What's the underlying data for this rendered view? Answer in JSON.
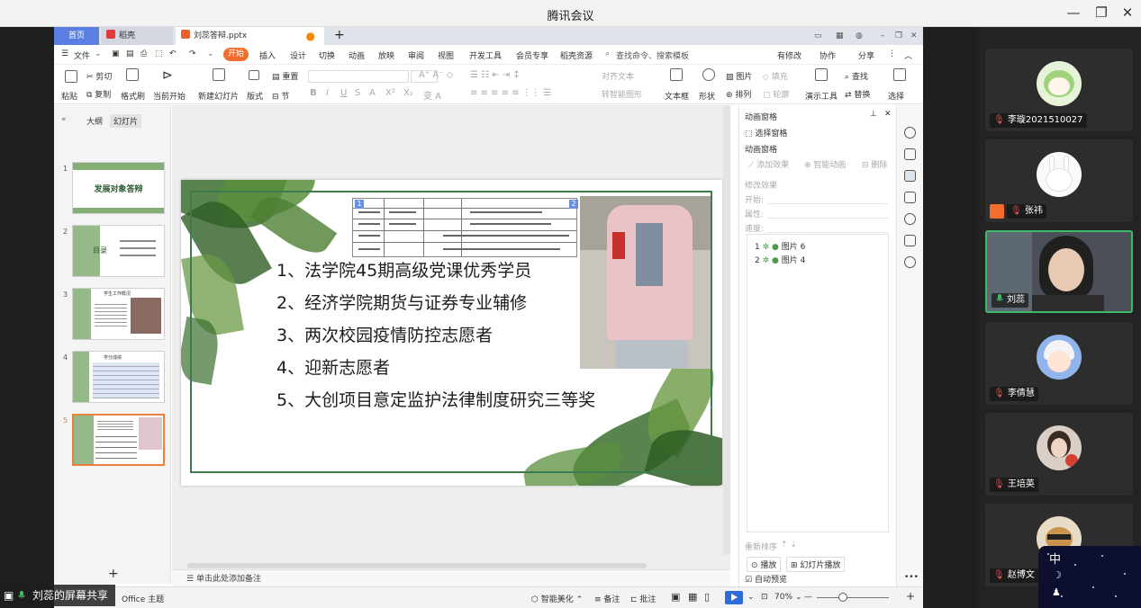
{
  "app": {
    "title": "腾讯会议"
  },
  "wps": {
    "tabs": {
      "home": "首页",
      "docer": "稻壳",
      "document": "刘蕊答辩.pptx"
    },
    "menu": {
      "file": "文件",
      "start": "开始",
      "items": [
        "插入",
        "设计",
        "切换",
        "动画",
        "放映",
        "审阅",
        "视图",
        "开发工具",
        "会员专享",
        "稻壳资源"
      ],
      "search_placeholder": "查找命令、搜索模板",
      "right": [
        "有修改",
        "协作",
        "分享"
      ]
    },
    "ribbon": {
      "paste": "粘贴",
      "cut": "剪切",
      "copy": "复制",
      "format_painter": "格式刷",
      "play_from_current": "当前开始",
      "new_slide": "新建幻灯片",
      "layout": "版式",
      "section": "节",
      "reset": "重置",
      "align_text": "对齐文本",
      "smart_shape": "转智能图形",
      "textbox": "文本框",
      "shape": "形状",
      "picture": "图片",
      "fill": "填充",
      "arrange": "排列",
      "outline": "轮廓",
      "present_tools": "演示工具",
      "find": "查找",
      "replace": "替换",
      "select": "选择"
    },
    "left_panel": {
      "tabs": [
        "大纲",
        "幻灯片"
      ],
      "thumbs": [
        {
          "num": "1",
          "title": "发展对象答辩"
        },
        {
          "num": "2",
          "title": "目录"
        },
        {
          "num": "3",
          "title": "学生工作概况"
        },
        {
          "num": "4",
          "title": "学分成绩"
        },
        {
          "num": "5",
          "title": ""
        }
      ],
      "add": "+"
    },
    "slide": {
      "tag_left": "1",
      "tag_right": "2",
      "items": [
        "1、法学院45期高级党课优秀学员",
        "2、经济学院期货与证券专业辅修",
        "3、两次校园疫情防控志愿者",
        "4、迎新志愿者",
        "5、大创项目意定监护法律制度研究三等奖"
      ]
    },
    "notes_placeholder": "单击此处添加备注",
    "anim_pane": {
      "title": "动画窗格",
      "select_pane": "选择窗格",
      "section_title": "动画窗格",
      "add_effect": "添加效果",
      "smart_anim": "智能动画",
      "delete": "删除",
      "modify": "修改效果",
      "start_label": "开始:",
      "property_label": "属性:",
      "speed_label": "速度:",
      "items": [
        {
          "num": "1",
          "name": "图片 6"
        },
        {
          "num": "2",
          "name": "图片 4"
        }
      ],
      "reorder": "重新排序",
      "play": "播放",
      "slideshow": "幻灯片播放",
      "auto_preview": "自动预览"
    },
    "status": {
      "theme": "Office 主题",
      "smart_beautify": "智能美化",
      "notes": "备注",
      "comments": "批注",
      "zoom": "70%"
    }
  },
  "share_label": "刘蕊的屏幕共享",
  "participants": [
    {
      "name": "李璇2021510027",
      "muted": true,
      "active": false,
      "avatar": "green-cabbage-avatar"
    },
    {
      "name": "张祎",
      "muted": true,
      "active": false,
      "avatar": "white-rabbit-avatar"
    },
    {
      "name": "刘蕊",
      "muted": false,
      "active": true,
      "avatar": "camera-video"
    },
    {
      "name": "李倩慧",
      "muted": true,
      "active": false,
      "avatar": "anime-girl-avatar"
    },
    {
      "name": "王培英",
      "muted": true,
      "active": false,
      "avatar": "photo-avatar"
    },
    {
      "name": "赵博文",
      "muted": true,
      "active": false,
      "avatar": "dog-avatar"
    }
  ],
  "ime": {
    "mode": "中"
  },
  "colors": {
    "accent_orange": "#f26c2e",
    "active_green": "#3dbb6a",
    "slide_frame": "#3e7b4e",
    "wps_blue": "#5b7fe0"
  }
}
